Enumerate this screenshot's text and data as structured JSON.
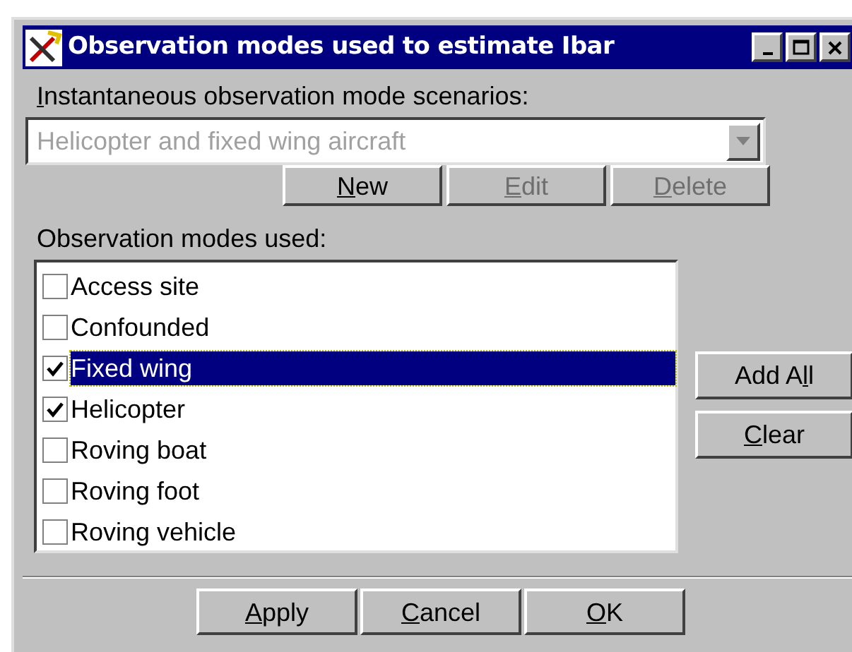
{
  "window": {
    "title": "Observation modes used to estimate Ibar"
  },
  "scenarios": {
    "label": {
      "key": "I",
      "after": "nstantaneous observation mode scenarios:"
    },
    "value": "Helicopter and fixed wing aircraft",
    "disabled": true
  },
  "scenario_buttons": [
    {
      "key": "N",
      "after": "ew",
      "disabled": false
    },
    {
      "key": "E",
      "after": "dit",
      "disabled": true
    },
    {
      "key": "D",
      "after": "elete",
      "disabled": true
    }
  ],
  "modes_label": "Observation modes used:",
  "modes": [
    {
      "label": "Access site",
      "checked": false,
      "selected": false
    },
    {
      "label": "Confounded",
      "checked": false,
      "selected": false
    },
    {
      "label": "Fixed wing",
      "checked": true,
      "selected": true
    },
    {
      "label": "Helicopter",
      "checked": true,
      "selected": false
    },
    {
      "label": "Roving boat",
      "checked": false,
      "selected": false
    },
    {
      "label": "Roving foot",
      "checked": false,
      "selected": false
    },
    {
      "label": "Roving vehicle",
      "checked": false,
      "selected": false
    }
  ],
  "side_buttons": [
    {
      "before": "Add A",
      "key": "l",
      "after": "l",
      "disabled": false
    },
    {
      "key": "C",
      "after": "lear",
      "disabled": false
    }
  ],
  "footer_buttons": [
    {
      "key": "A",
      "after": "pply",
      "disabled": false
    },
    {
      "key": "C",
      "after": "ancel",
      "disabled": false
    },
    {
      "key": "O",
      "after": "K",
      "disabled": false
    }
  ]
}
